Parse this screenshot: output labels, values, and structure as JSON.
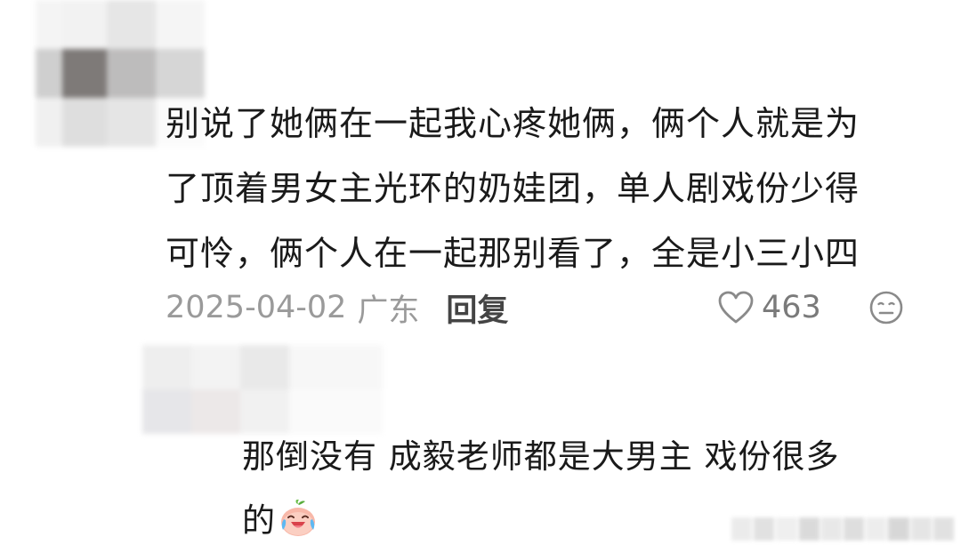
{
  "avatar1": {
    "cells": [
      "#f4f4f4",
      "#f2f2f2",
      "#e6e6e6",
      "#f5f5f5",
      "#ffffff",
      "#cfcfcf",
      "#7e7a78",
      "#bdbcbc",
      "#d6d6d6",
      "#ffffff",
      "#f0f0f0",
      "#dedede",
      "#e5e5e5",
      "#fbfbfb",
      "#ffffff"
    ]
  },
  "avatar2": {
    "cells": [
      "#eeeeee",
      "#f3f3f3",
      "#e9e9e9",
      "#f7f7f7",
      "#e6e6e9",
      "#ece8e8",
      "#f1f1f1",
      "#fafafa"
    ]
  },
  "comment": {
    "text": "别说了她俩在一起我心疼她俩，俩个人就是为\n了顶着男女主光环的奶娃团，单人剧戏份少得\n可怜，俩个人在一起那别看了，全是小三小四",
    "date": "2025-04-02",
    "location": "广东",
    "reply_label": "回复",
    "like_count": "463",
    "like_icon": "heart-outline-icon",
    "reaction_icon": "meh-face-icon"
  },
  "reply": {
    "text": "那倒没有 成毅老师都是大男主 戏份很多\n的",
    "trailing_emoji": "crying-laughing-peach-emoji"
  },
  "colors": {
    "text_primary": "#1a1a1a",
    "meta_gray": "#9a9a9a",
    "icon_gray": "#8a8a8a"
  }
}
